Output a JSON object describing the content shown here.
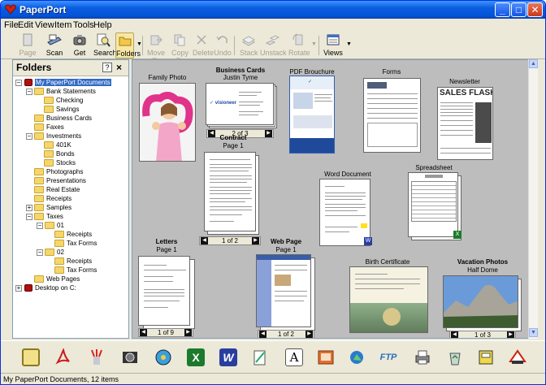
{
  "window": {
    "title": "PaperPort"
  },
  "menu": [
    "File",
    "Edit",
    "View",
    "Item",
    "Tools",
    "Help"
  ],
  "toolbar": {
    "page": "Page",
    "scan": "Scan",
    "get": "Get",
    "search": "Search",
    "folders": "Folders",
    "move_to": "Move To",
    "copy_to": "Copy To",
    "delete": "Delete",
    "undo": "Undo",
    "stack": "Stack",
    "unstack": "Unstack",
    "rotate": "Rotate",
    "views": "Views"
  },
  "folders_pane": {
    "title": "Folders",
    "help": "?",
    "close": "×"
  },
  "tree": {
    "root": "My PaperPort Documents",
    "bank": "Bank Statements",
    "checking": "Checking",
    "savings": "Savings",
    "business_cards": "Business Cards",
    "faxes": "Faxes",
    "investments": "Investments",
    "k401": "401K",
    "bonds": "Bonds",
    "stocks": "Stocks",
    "photographs": "Photographs",
    "presentations": "Presentations",
    "real_estate": "Real Estate",
    "receipts": "Receipts",
    "samples": "Samples",
    "taxes": "Taxes",
    "t01": "01",
    "t01_receipts": "Receipts",
    "t01_taxforms": "Tax Forms",
    "t02": "02",
    "t02_receipts": "Receipts",
    "t02_taxforms": "Tax Forms",
    "web_pages": "Web Pages",
    "desktop": "Desktop on C:"
  },
  "items": {
    "family_photo": {
      "title": "Family Photo"
    },
    "business_cards": {
      "title": "Business Cards",
      "sub": "Justin Tyme",
      "page": "2 of 3"
    },
    "pdf_brochure": {
      "title": "PDF Brouchure"
    },
    "forms": {
      "title": "Forms"
    },
    "newsletter": {
      "title": "Newsletter",
      "headline": "SALES FLASH!"
    },
    "contract": {
      "title": "Contract",
      "sub": "Page 1",
      "page": "1 of 2"
    },
    "word_document": {
      "title": "Word Document"
    },
    "spreadsheet": {
      "title": "Spreadsheet"
    },
    "letters": {
      "title": "Letters",
      "sub": "Page 1",
      "page": "1 of 9"
    },
    "web_page": {
      "title": "Web Page",
      "sub": "Page 1",
      "page": "1 of 2"
    },
    "birth_certificate": {
      "title": "Birth Certificate"
    },
    "vacation_photos": {
      "title": "Vacation Photos",
      "sub": "Half Dome",
      "page": "1 of 3"
    }
  },
  "status": {
    "text": "My PaperPort Documents, 12 items"
  },
  "colors": {
    "title_blue": "#0453d6",
    "desktop_gray": "#bdbdbd",
    "chrome": "#ece9d8"
  }
}
